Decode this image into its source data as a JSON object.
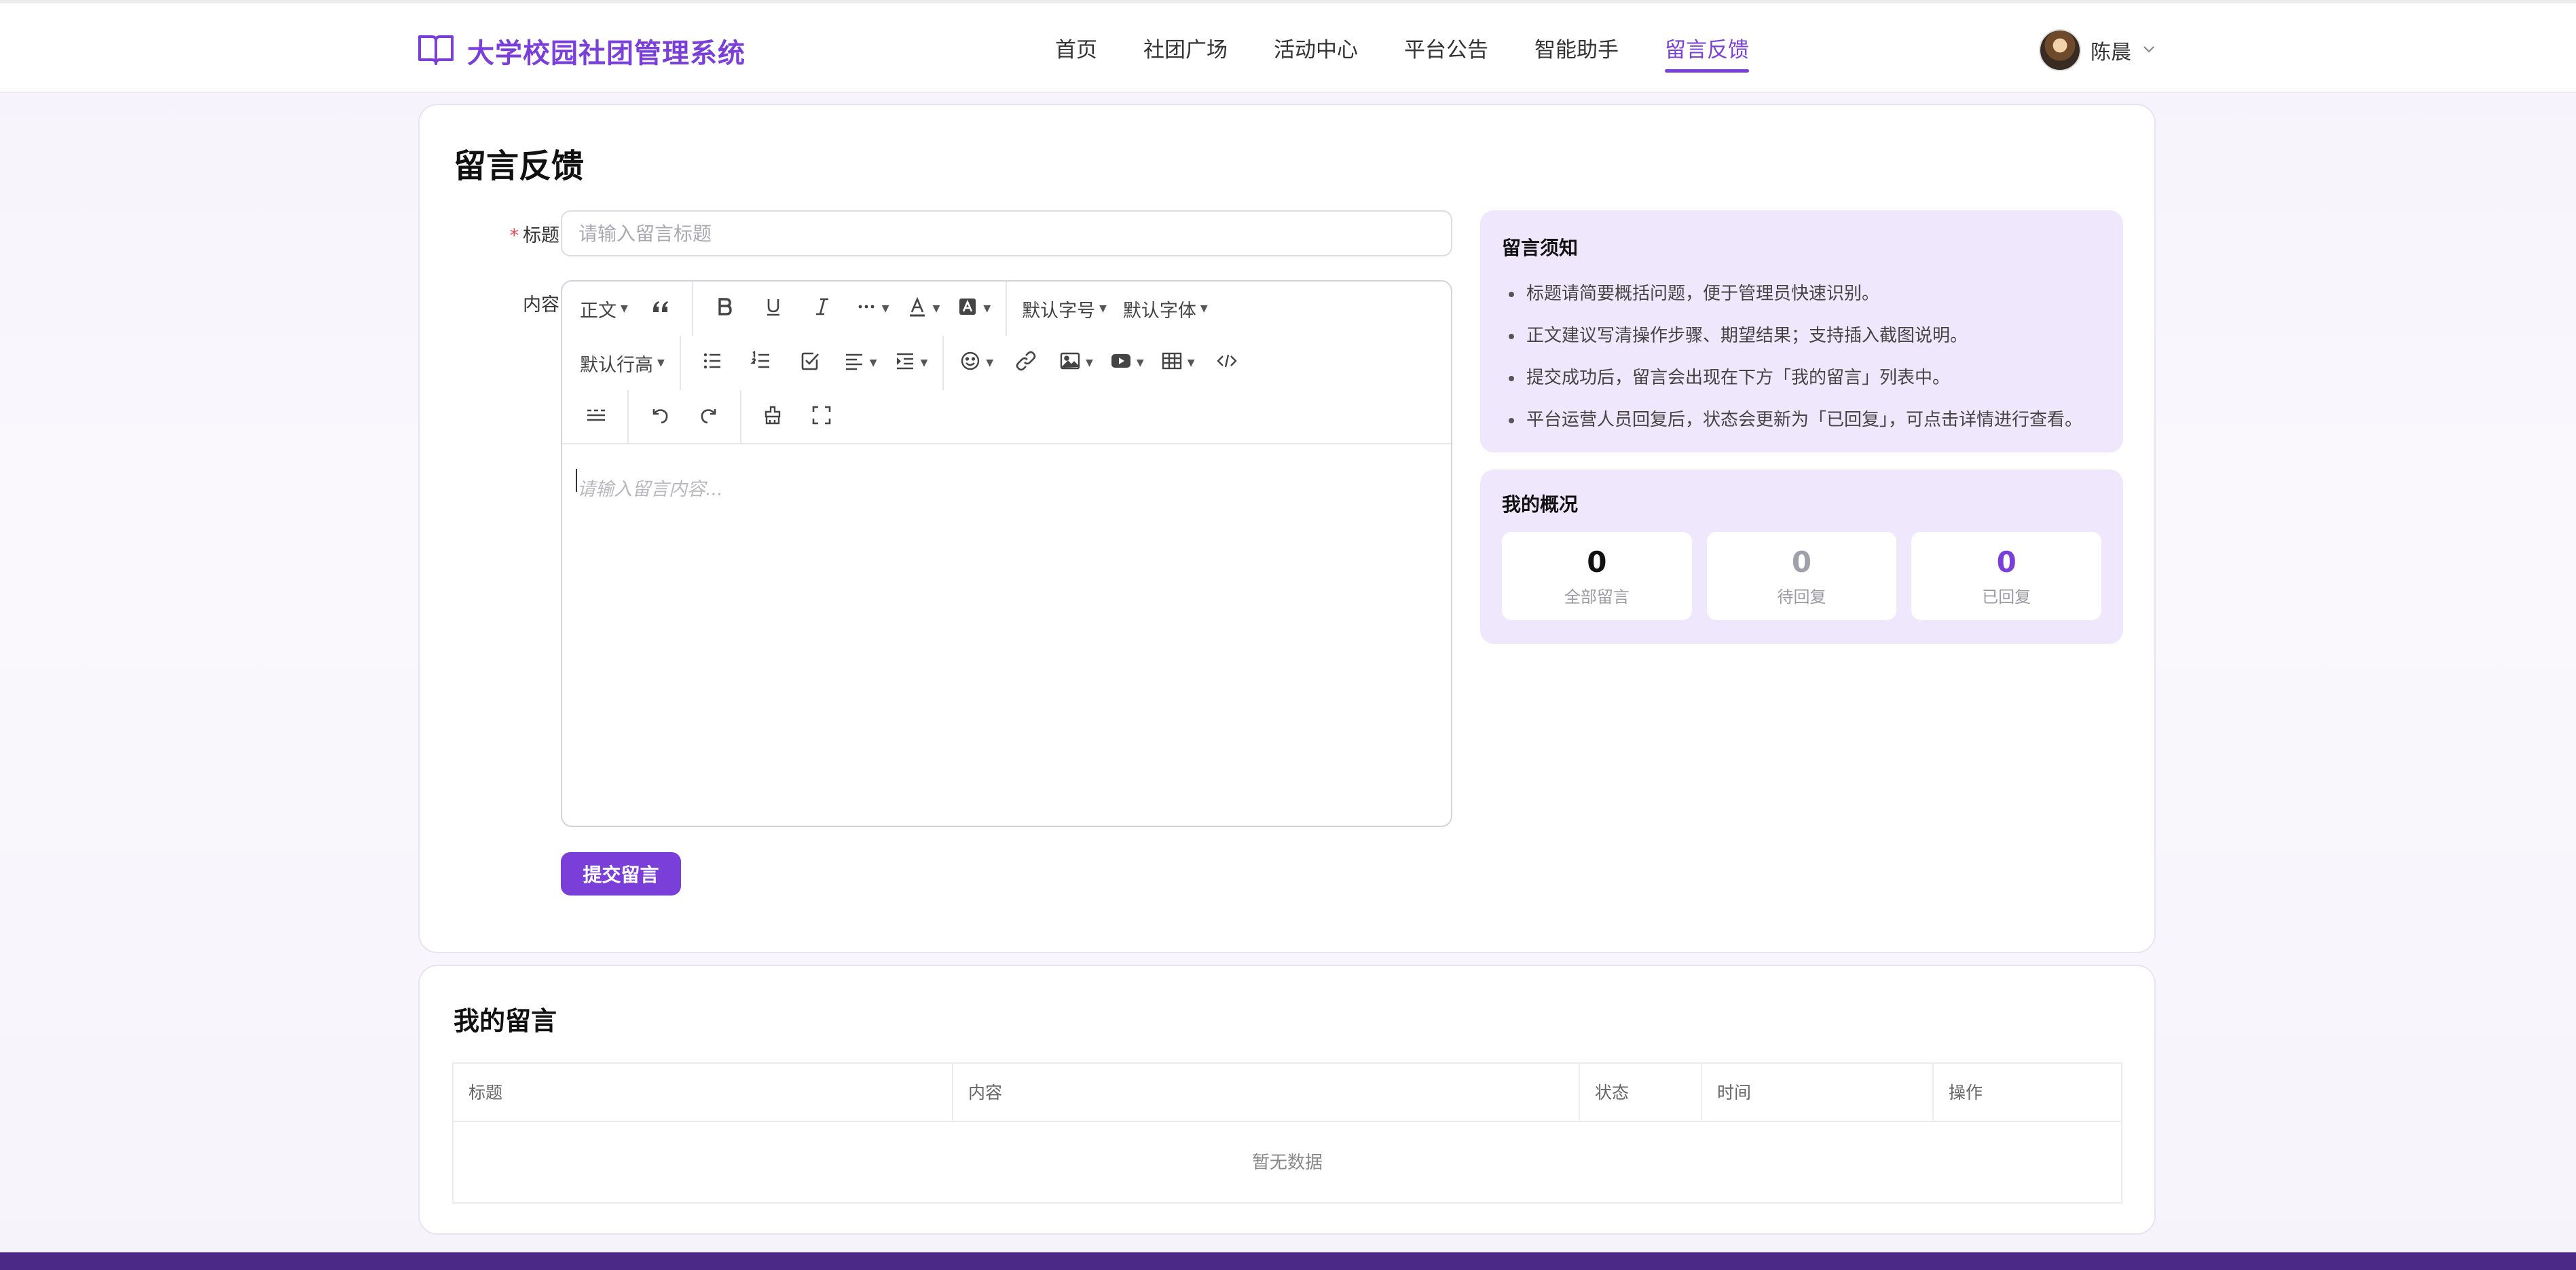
{
  "brand": {
    "title": "大学校园社团管理系统",
    "icon": "book-open-icon"
  },
  "nav": {
    "items": [
      {
        "label": "首页",
        "active": false
      },
      {
        "label": "社团广场",
        "active": false
      },
      {
        "label": "活动中心",
        "active": false
      },
      {
        "label": "平台公告",
        "active": false
      },
      {
        "label": "智能助手",
        "active": false
      },
      {
        "label": "留言反馈",
        "active": true
      }
    ]
  },
  "user": {
    "name": "陈晨",
    "avatar": "avatar-photo"
  },
  "form": {
    "page_title": "留言反馈",
    "title_label": "标题",
    "title_required_mark": "*",
    "title_placeholder": "请输入留言标题",
    "title_value": "",
    "content_label": "内容",
    "content_placeholder": "请输入留言内容...",
    "submit_label": "提交留言"
  },
  "toolbar": {
    "paragraph_label": "正文",
    "font_size_label": "默认字号",
    "font_family_label": "默认字体",
    "line_height_label": "默认行高",
    "icons": [
      "quote-icon",
      "bold-icon",
      "underline-icon",
      "italic-icon",
      "more-icon",
      "font-color-icon",
      "bg-color-icon",
      "bulleted-list-icon",
      "numbered-list-icon",
      "todo-icon",
      "align-icon",
      "indent-icon",
      "emoji-icon",
      "link-icon",
      "image-icon",
      "video-icon",
      "table-icon",
      "code-icon",
      "divider-icon",
      "undo-icon",
      "redo-icon",
      "clear-format-icon",
      "fullscreen-icon"
    ]
  },
  "notice": {
    "title": "留言须知",
    "items": [
      "标题请简要概括问题，便于管理员快速识别。",
      "正文建议写清操作步骤、期望结果；支持插入截图说明。",
      "提交成功后，留言会出现在下方「我的留言」列表中。",
      "平台运营人员回复后，状态会更新为「已回复」，可点击详情进行查看。"
    ]
  },
  "overview": {
    "title": "我的概况",
    "stats": [
      {
        "value": "0",
        "label": "全部留言"
      },
      {
        "value": "0",
        "label": "待回复"
      },
      {
        "value": "0",
        "label": "已回复"
      }
    ]
  },
  "messages": {
    "title": "我的留言",
    "columns": [
      "标题",
      "内容",
      "状态",
      "时间",
      "操作"
    ],
    "empty_text": "暂无数据"
  },
  "colors": {
    "accent": "#7b3fd9",
    "panel_bg": "#efe7fb",
    "required": "#e5484d"
  }
}
